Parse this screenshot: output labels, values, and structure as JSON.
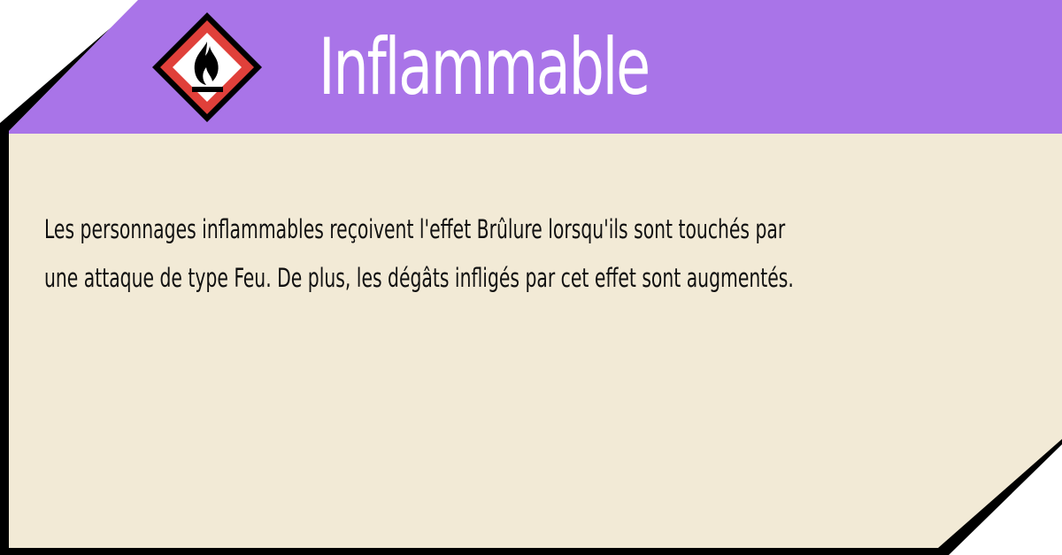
{
  "card": {
    "title": "Inflammable",
    "icon": "flammable-hazard-icon",
    "description_lines": [
      "Les personnages inflammables reçoivent l'effet Brûlure lorsqu'ils sont touchés par",
      "une attaque de type Feu. De plus, les dégâts infligés par cet effet sont augmentés."
    ]
  },
  "colors": {
    "header": "#a974e8",
    "body": "#f2ead6",
    "border": "#000000",
    "hazard_red": "#e0403a",
    "text": "#111111",
    "title_text": "#ffffff"
  }
}
